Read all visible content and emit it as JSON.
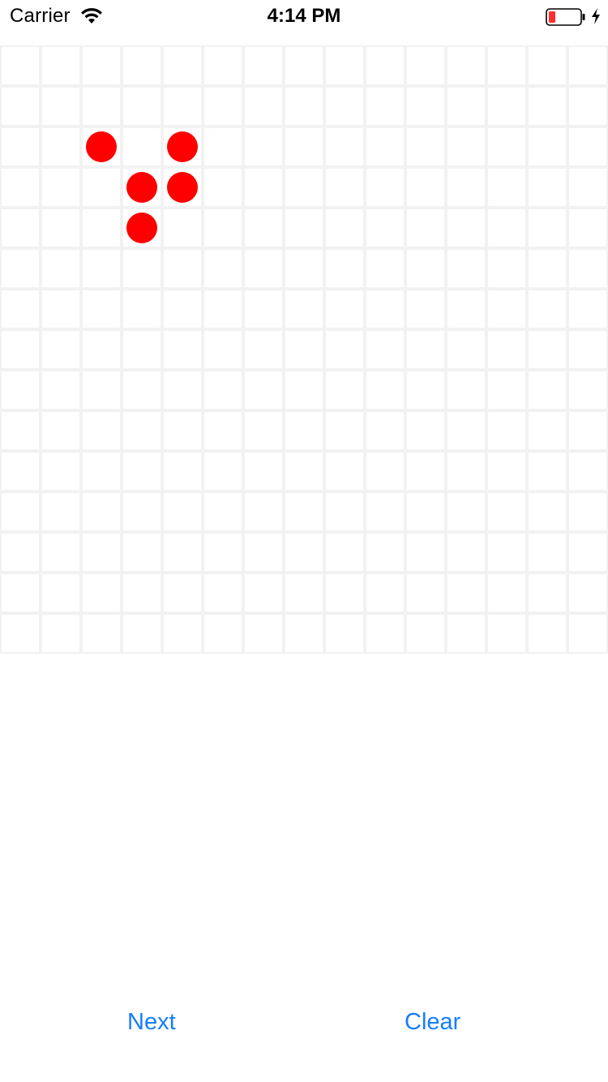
{
  "status_bar": {
    "carrier": "Carrier",
    "time": "4:14 PM",
    "wifi_icon": "wifi-icon",
    "battery_icon": "battery-low-icon",
    "charging_icon": "bolt-icon",
    "battery_color": "#ff2d2d"
  },
  "board": {
    "rows": 15,
    "cols": 15,
    "grid_line_color": "#f2f2f2",
    "live_color": "#ff0000",
    "live_cells": [
      {
        "row": 2,
        "col": 2
      },
      {
        "row": 2,
        "col": 4
      },
      {
        "row": 3,
        "col": 3
      },
      {
        "row": 3,
        "col": 4
      },
      {
        "row": 4,
        "col": 3
      }
    ]
  },
  "controls": {
    "next_label": "Next",
    "clear_label": "Clear",
    "accent_color": "#157efb"
  }
}
